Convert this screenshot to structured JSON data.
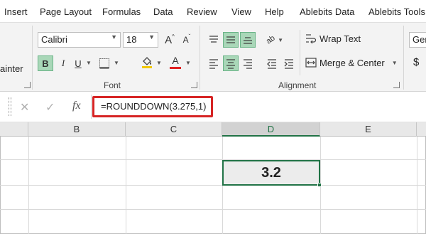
{
  "menu": {
    "items": [
      "Insert",
      "Page Layout",
      "Formulas",
      "Data",
      "Review",
      "View",
      "Help",
      "Ablebits Data",
      "Ablebits Tools"
    ]
  },
  "ribbon": {
    "clipboard_partial": "ainter",
    "font": {
      "name": "Calibri",
      "size": "18",
      "group_label": "Font",
      "bold": "B",
      "italic": "I",
      "underline": "U",
      "grow": "A",
      "shrink": "A",
      "font_color": "A",
      "font_color_swatch": "#e02020",
      "fill_color_swatch": "#f2c800"
    },
    "alignment": {
      "group_label": "Alignment",
      "orientation_label": "ab",
      "wrap_text": "Wrap Text",
      "merge_center": "Merge & Center"
    },
    "number": {
      "format_partial": "Ger",
      "currency": "$"
    }
  },
  "formula_bar": {
    "cancel": "✕",
    "enter": "✓",
    "fx": "fx",
    "formula": "=ROUNDDOWN(3.275,1)"
  },
  "sheet": {
    "columns": [
      "B",
      "C",
      "D",
      "E"
    ],
    "active_column": "D",
    "active_cell_value": "3.2"
  },
  "colors": {
    "accent_green": "#217346",
    "highlight_red": "#d62424",
    "selected_button": "#a9d7b8"
  }
}
